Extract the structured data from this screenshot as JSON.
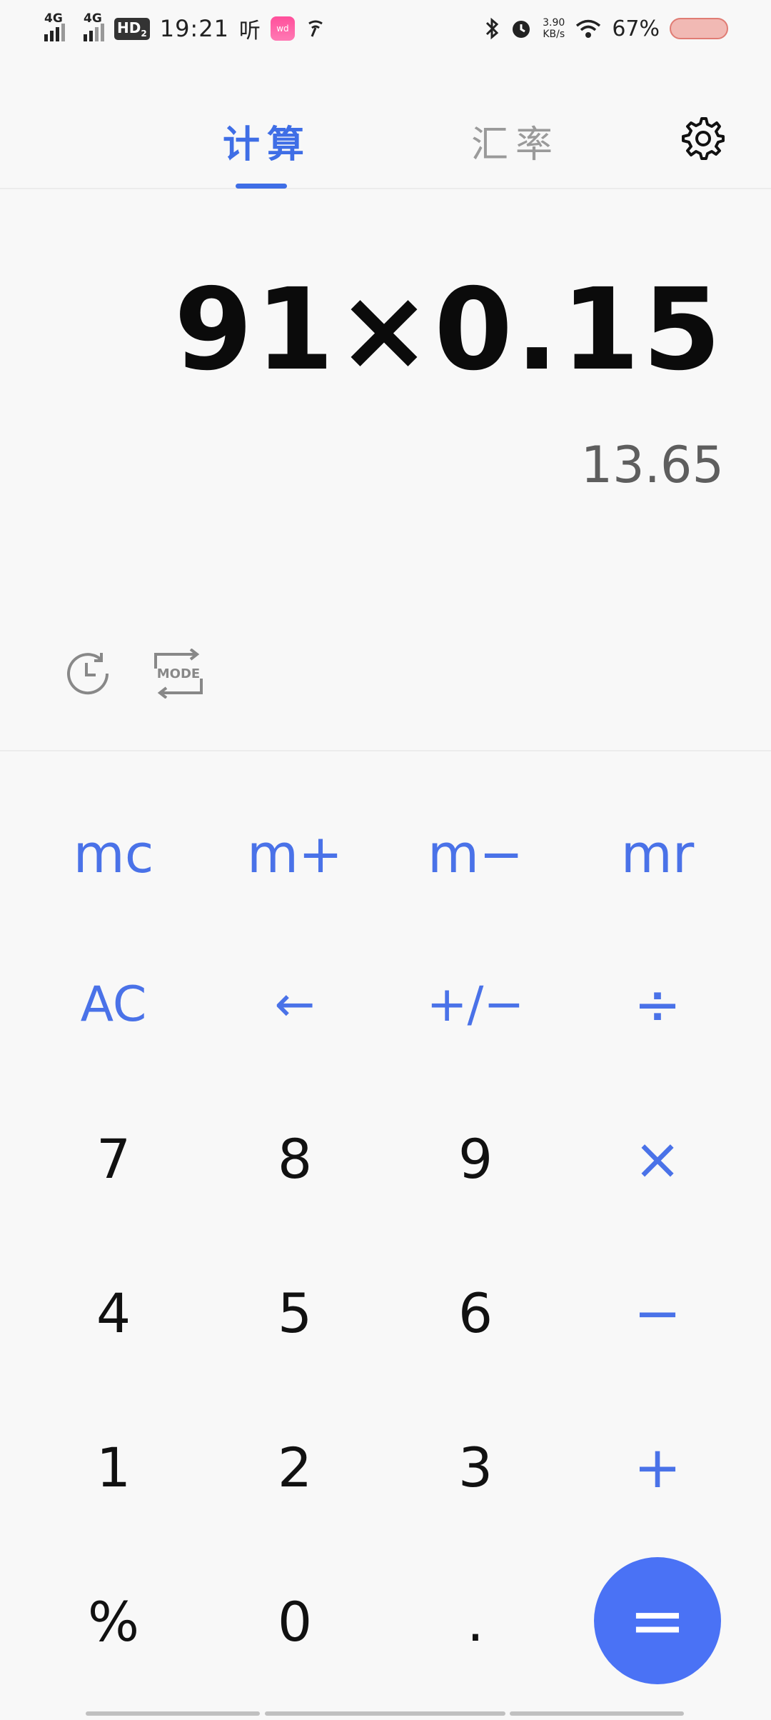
{
  "status_bar": {
    "signal1_label": "4G",
    "signal2_label": "4G",
    "hd_label": "HD",
    "hd_sub": "2",
    "time": "19:21",
    "listen_label": "听",
    "app_badge": "wd",
    "speed_value": "3.90",
    "speed_unit": "KB/s",
    "battery": "67%"
  },
  "tabs": [
    {
      "label": "计算",
      "active": true
    },
    {
      "label": "汇率",
      "active": false
    }
  ],
  "display": {
    "expression": "91×0.15",
    "result": "13.65"
  },
  "keypad": {
    "row0": [
      "mc",
      "m+",
      "m−",
      "mr"
    ],
    "row1": [
      "AC",
      "←",
      "+/−",
      "÷"
    ],
    "row2": [
      "7",
      "8",
      "9",
      "×"
    ],
    "row3": [
      "4",
      "5",
      "6",
      "−"
    ],
    "row4": [
      "1",
      "2",
      "3",
      "+"
    ],
    "row5": [
      "%",
      "0",
      "."
    ],
    "equals": "="
  },
  "mode_label": "MODE",
  "colors": {
    "accent": "#4a72e8",
    "equals_bg": "#4a72f5",
    "inactive_tab": "#9a9a9a"
  }
}
